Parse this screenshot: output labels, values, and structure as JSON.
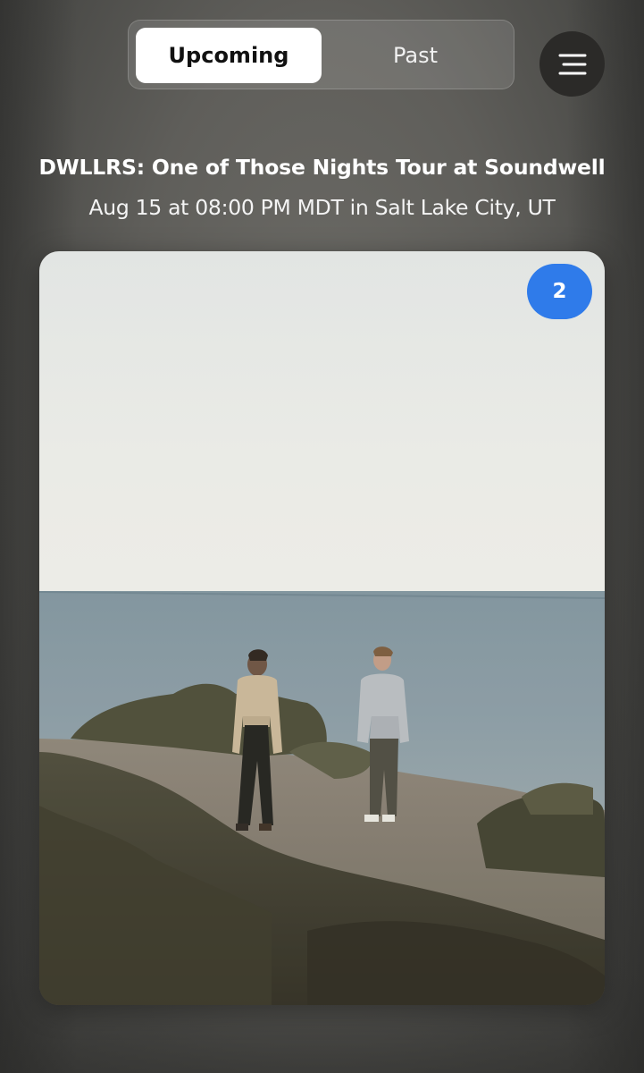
{
  "tabs": {
    "upcoming_label": "Upcoming",
    "past_label": "Past",
    "selected": "Upcoming"
  },
  "menu": {
    "icon": "hamburger-menu-icon"
  },
  "event": {
    "title": "DWLLRS: One of Those Nights Tour at Soundwell",
    "subtitle": "Aug 15 at 08:00 PM MDT in Salt Lake City, UT"
  },
  "card": {
    "image_description_icon": "event-photo",
    "badge_count": "2"
  },
  "colors": {
    "accent_blue": "#2f7bea",
    "menu_bg": "#2b2a28",
    "active_tab_bg": "#ffffff"
  }
}
